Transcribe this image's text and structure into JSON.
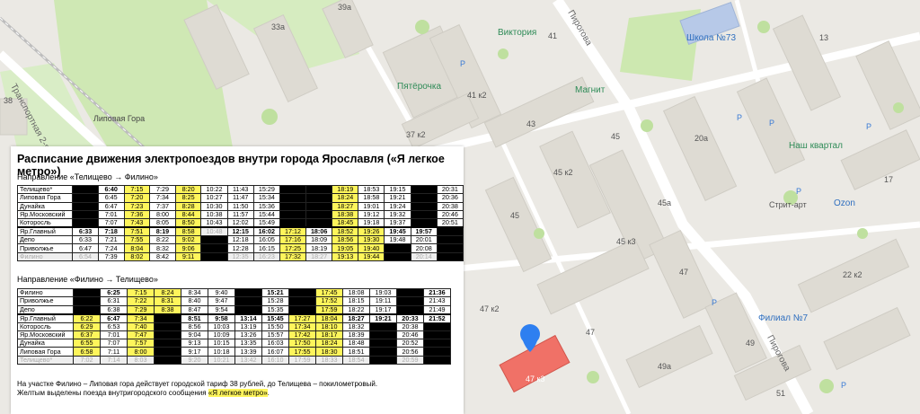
{
  "map": {
    "labels": {
      "addr_39a": "39а",
      "addr_33a": "33а",
      "addr_41k2": "41 к2",
      "addr_41": "41",
      "addr_37k2": "37 к2",
      "addr_43": "43",
      "addr_45": "45",
      "addr_45k2": "45 к2",
      "addr_45a": "45а",
      "addr_45k3": "45 к3",
      "addr_47": "47",
      "addr_47k2": "47 к2",
      "addr_47k3": "47 к3",
      "addr_49": "49",
      "addr_49a": "49а",
      "addr_51": "51",
      "addr_20a": "20а",
      "addr_13": "13",
      "addr_17": "17",
      "addr_22k2": "22 к2",
      "addr_38": "38",
      "street_transport": "Транспортная 2-я",
      "street_pirogova_top": "Пирогова",
      "street_pirogova_bottom": "Пирогова",
      "station": "Липовая Гора",
      "poi_victoria": "Виктория",
      "poi_pyaterochka": "Пятёрочка",
      "poi_magnit": "Магнит",
      "poi_school": "Школа №73",
      "poi_nash_kvartal": "Наш квартал",
      "poi_street_art": "Стрит-арт",
      "poi_ozon": "Ozon",
      "poi_filial": "Филиал №7",
      "parking": "P"
    }
  },
  "schedule": {
    "title": "Расписание движения электропоездов внутри города Ярославля («Я легкое метро»)",
    "dir1": "Направление «Телищево → Филино»",
    "dir2": "Направление «Филино → Телищево»",
    "t1": [
      [
        "Телищево*",
        "b",
        "6:40",
        "7:15",
        "7:29",
        "8:20",
        "10:22",
        "11:43",
        "15:29",
        "b",
        "b",
        "18:19",
        "18:53",
        "19:15",
        "b",
        "20:31"
      ],
      [
        "Липовая Гора",
        "b",
        "6:45",
        "7:20",
        "7:34",
        "8:25",
        "10:27",
        "11:47",
        "15:34",
        "b",
        "b",
        "18:24",
        "18:58",
        "19:21",
        "b",
        "20:36"
      ],
      [
        "Дунайка",
        "b",
        "6:47",
        "7:23",
        "7:37",
        "8:28",
        "10:30",
        "11:50",
        "15:36",
        "b",
        "b",
        "18:27",
        "19:01",
        "19:24",
        "b",
        "20:38"
      ],
      [
        "Яр.Московский",
        "b",
        "7:01",
        "7:36",
        "8:00",
        "8:44",
        "10:38",
        "11:57",
        "15:44",
        "b",
        "b",
        "18:38",
        "19:12",
        "19:32",
        "19:40",
        "20:46"
      ],
      [
        "Которосль",
        "b",
        "7:07",
        "7:43",
        "8:05",
        "8:50",
        "10:43",
        "12:02",
        "15:49",
        "b",
        "b",
        "18:45",
        "19:18",
        "19:37",
        "19:45",
        "20:51"
      ],
      [
        "Яр.Главный",
        "6:33",
        "7:18",
        "7:51",
        "8:19",
        "8:58",
        "10:48",
        "12:15",
        "16:02",
        "17:12",
        "18:06",
        "18:52",
        "19:26",
        "19:45",
        "19:57",
        "b"
      ],
      [
        "Депо",
        "6:33",
        "7:21",
        "7:55",
        "8:22",
        "9:02",
        "b",
        "12:18",
        "16:05",
        "17:16",
        "18:09",
        "18:56",
        "19:30",
        "19:48",
        "20:01",
        "b"
      ],
      [
        "Приволжье",
        "6:47",
        "7:24",
        "8:04",
        "8:32",
        "9:06",
        "b",
        "12:28",
        "16:15",
        "17:25",
        "18:19",
        "19:05",
        "19:40",
        "b",
        "20:08",
        "b"
      ],
      [
        "Филино",
        "6:54",
        "7:39",
        "8:02",
        "8:42",
        "9:11",
        "b",
        "12:35",
        "16:23",
        "17:32",
        "18:27",
        "19:13",
        "19:44",
        "b",
        "20:14",
        "b"
      ]
    ],
    "t1_styles": [
      [
        "",
        "b",
        "bold",
        "y",
        "",
        "y",
        "",
        "",
        "",
        "b",
        "b",
        "y",
        "",
        "",
        "b",
        ""
      ],
      [
        "",
        "b",
        "",
        "y",
        "",
        "y",
        "",
        "",
        "",
        "b",
        "b",
        "y",
        "",
        "",
        "b",
        ""
      ],
      [
        "",
        "b",
        "",
        "y",
        "",
        "y",
        "",
        "",
        "",
        "b",
        "b",
        "y",
        "",
        "",
        "b",
        ""
      ],
      [
        "",
        "b",
        "",
        "y",
        "",
        "y",
        "",
        "",
        "",
        "b",
        "b",
        "y",
        "",
        "",
        "b",
        ""
      ],
      [
        "",
        "b",
        "",
        "y",
        "",
        "y",
        "",
        "",
        "",
        "b",
        "b",
        "y",
        "",
        "",
        "b",
        ""
      ],
      [
        "",
        "bold",
        "bold",
        "y",
        "bold",
        "y",
        "g",
        "bold",
        "bold",
        "y",
        "bold",
        "y",
        "y",
        "bold",
        "bold",
        "b"
      ],
      [
        "",
        "",
        "",
        "y",
        "",
        "y",
        "b",
        "",
        "",
        "y",
        "",
        "y",
        "y",
        "",
        "",
        "b"
      ],
      [
        "",
        "",
        "",
        "y",
        "",
        "y",
        "b",
        "",
        "",
        "y",
        "",
        "y",
        "y",
        "b",
        "",
        "b"
      ],
      [
        "g",
        "g",
        "",
        "y",
        "",
        "y",
        "b",
        "g",
        "g",
        "y",
        "g",
        "y",
        "y",
        "b",
        "g",
        "b"
      ]
    ],
    "t2": [
      [
        "Филино",
        "b",
        "6:25",
        "7:15",
        "8:24",
        "8:34",
        "9:40",
        "b",
        "15:21",
        "b",
        "17:45",
        "18:08",
        "19:03",
        "b",
        "21:36"
      ],
      [
        "Приволжье",
        "b",
        "6:31",
        "7:22",
        "8:31",
        "8:40",
        "9:47",
        "b",
        "15:28",
        "b",
        "17:52",
        "18:15",
        "19:11",
        "b",
        "21:43"
      ],
      [
        "Депо",
        "b",
        "6:38",
        "7:29",
        "8:38",
        "8:47",
        "9:54",
        "b",
        "15:35",
        "b",
        "17:59",
        "18:22",
        "19:17",
        "b",
        "21:49"
      ],
      [
        "Яр.Главный",
        "6:22",
        "6:47",
        "7:34",
        "b",
        "8:51",
        "9:58",
        "13:14",
        "15:45",
        "17:27",
        "18:04",
        "18:27",
        "19:21",
        "20:33",
        "21:52"
      ],
      [
        "Которосль",
        "6:29",
        "6:53",
        "7:40",
        "b",
        "8:56",
        "10:03",
        "13:19",
        "15:50",
        "17:34",
        "18:10",
        "18:32",
        "b",
        "20:38",
        "b"
      ],
      [
        "Яр.Московский",
        "6:37",
        "7:01",
        "7:47",
        "b",
        "9:04",
        "10:09",
        "13:26",
        "15:57",
        "17:42",
        "18:17",
        "18:39",
        "b",
        "20:46",
        "b"
      ],
      [
        "Дунайка",
        "6:55",
        "7:07",
        "7:57",
        "b",
        "9:13",
        "10:15",
        "13:35",
        "16:03",
        "17:50",
        "18:24",
        "18:48",
        "b",
        "20:52",
        "b"
      ],
      [
        "Липовая Гора",
        "6:58",
        "7:11",
        "8:00",
        "b",
        "9:17",
        "10:18",
        "13:39",
        "16:07",
        "17:55",
        "18:30",
        "18:51",
        "b",
        "20:56",
        "b"
      ],
      [
        "Телищево*",
        "7:02",
        "7:14",
        "8:03",
        "b",
        "9:20",
        "10:21",
        "13:42",
        "16:10",
        "17:59",
        "18:33",
        "18:54",
        "b",
        "20:59",
        "b"
      ]
    ],
    "t2_styles": [
      [
        "",
        "b",
        "bold",
        "y",
        "y",
        "",
        "",
        "b",
        "bold",
        "b",
        "y",
        "",
        "",
        "b",
        "bold"
      ],
      [
        "",
        "b",
        "",
        "y",
        "y",
        "",
        "",
        "b",
        "",
        "b",
        "y",
        "",
        "",
        "b",
        ""
      ],
      [
        "",
        "b",
        "",
        "y",
        "y",
        "",
        "",
        "b",
        "",
        "b",
        "y",
        "",
        "",
        "b",
        ""
      ],
      [
        "",
        "y",
        "bold",
        "y",
        "b",
        "bold",
        "bold",
        "bold",
        "bold",
        "y",
        "y",
        "bold",
        "bold",
        "bold",
        "bold"
      ],
      [
        "",
        "y",
        "",
        "y",
        "b",
        "",
        "",
        "",
        "",
        "y",
        "y",
        "",
        "b",
        "",
        "b"
      ],
      [
        "",
        "y",
        "",
        "y",
        "b",
        "",
        "",
        "",
        "",
        "y",
        "y",
        "",
        "b",
        "",
        "b"
      ],
      [
        "",
        "y",
        "",
        "y",
        "b",
        "",
        "",
        "",
        "",
        "y",
        "y",
        "",
        "b",
        "",
        "b"
      ],
      [
        "",
        "y",
        "",
        "y",
        "b",
        "",
        "",
        "",
        "",
        "y",
        "y",
        "",
        "b",
        "",
        "b"
      ],
      [
        "g",
        "g",
        "g",
        "g",
        "b",
        "g",
        "g",
        "g",
        "g",
        "g",
        "g",
        "g",
        "b",
        "g",
        "b"
      ]
    ],
    "note1": "На участке Филино – Липовая гора действует городской тариф 38 рублей, до Телищева – покилометровый.",
    "note2_pre": "Желтым выделены поезда внутригородского сообщения ",
    "note2_hl": "«Я легкое метро»",
    "note2_post": "."
  }
}
